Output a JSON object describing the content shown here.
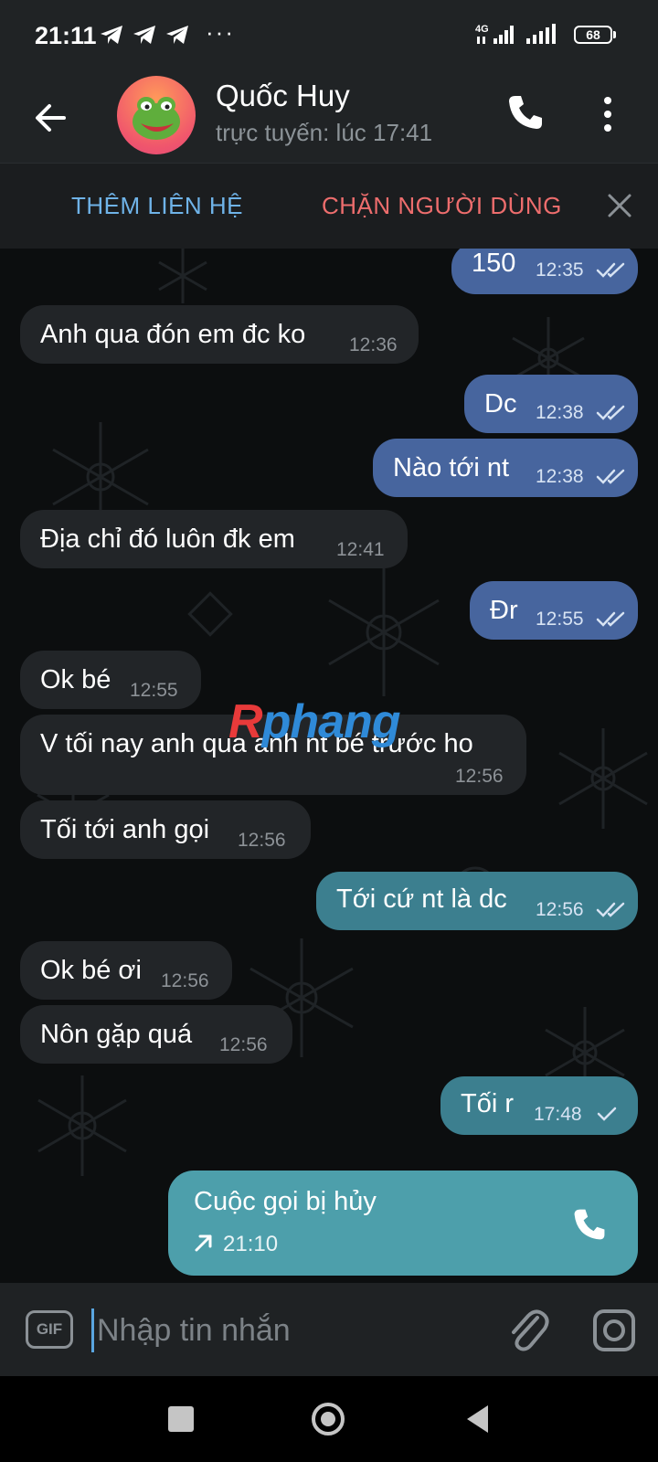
{
  "status_bar": {
    "time": "21:11",
    "dots": "···",
    "network": "4G",
    "battery": "68"
  },
  "header": {
    "contact_name": "Quốc Huy",
    "contact_status": "trực tuyến: lúc 17:41"
  },
  "action_bar": {
    "add_contact": "THÊM LIÊN HỆ",
    "block_user": "CHẶN NGƯỜI DÙNG"
  },
  "messages": [
    {
      "dir": "out",
      "text": "150",
      "time": "12:35",
      "read": true
    },
    {
      "dir": "in",
      "text": "Anh qua đón em đc ko",
      "time": "12:36"
    },
    {
      "dir": "out",
      "text": "Dc",
      "time": "12:38",
      "read": true
    },
    {
      "dir": "out",
      "text": "Nào tới nt",
      "time": "12:38",
      "read": true
    },
    {
      "dir": "in",
      "text": "Địa chỉ đó luôn đk em",
      "time": "12:41"
    },
    {
      "dir": "out",
      "text": "Đr",
      "time": "12:55",
      "read": true
    },
    {
      "dir": "in",
      "text": "Ok bé",
      "time": "12:55"
    },
    {
      "dir": "in",
      "text": "V tối nay anh qua anh nt bé trước ho",
      "time": "12:56"
    },
    {
      "dir": "in",
      "text": "Tối tới anh gọi",
      "time": "12:56"
    },
    {
      "dir": "out",
      "text": "Tới cứ nt là dc",
      "time": "12:56",
      "read": true
    },
    {
      "dir": "in",
      "text": "Ok bé ơi",
      "time": "12:56"
    },
    {
      "dir": "in",
      "text": "Nôn gặp quá",
      "time": "12:56"
    },
    {
      "dir": "out",
      "text": "Tối r",
      "time": "17:48",
      "read": false
    }
  ],
  "call_message": {
    "title": "Cuộc gọi bị hủy",
    "time": "21:10"
  },
  "watermark": {
    "first": "R",
    "rest": "phang"
  },
  "input": {
    "placeholder": "Nhập tin nhắn",
    "gif_label": "GIF"
  }
}
